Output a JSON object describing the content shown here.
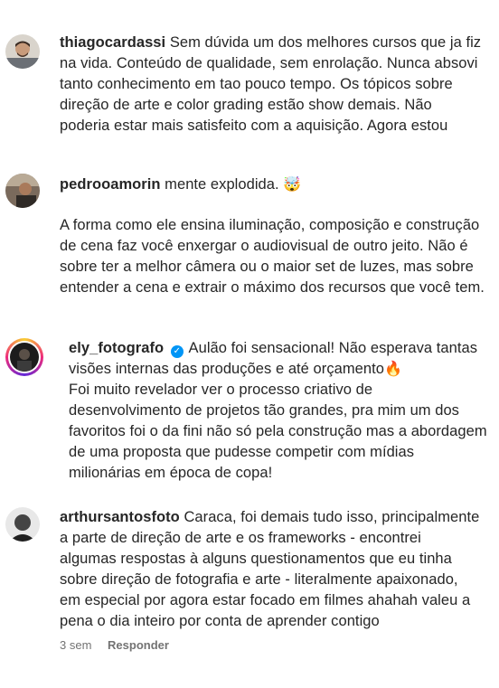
{
  "comments": [
    {
      "username": "thiagocardassi",
      "lines": [
        "Sem dúvida um dos melhores cursos que ja fiz",
        "na vida. Conteúdo de qualidade, sem enrolação. Nunca absovi",
        "tanto conhecimento em tao pouco tempo. Os tópicos sobre",
        "direção de arte e color grading estão show demais. Não",
        "poderia estar mais satisfeito com a aquisição. Agora estou"
      ]
    },
    {
      "username": "pedrooamorin",
      "first_text": "mente explodida.",
      "emoji": "🤯",
      "paragraph": [
        "A forma como ele ensina iluminação, composição e construção",
        "de cena faz você enxergar o audiovisual de outro jeito. Não é",
        "sobre ter a melhor câmera ou o maior set de luzes, mas sobre",
        "entender a cena e extrair o máximo dos recursos que você tem."
      ]
    },
    {
      "username": "ely_fotografo",
      "verified": "✓",
      "first_text": "Aulão foi sensacional! Não esperava tantas",
      "second_text": "visões internas das produções e até orçamento",
      "emoji": "🔥",
      "paragraph": [
        "Foi muito revelador ver o processo criativo de",
        "desenvolvimento de projetos tão grandes, pra mim um dos",
        "favoritos foi o da fini não só pela construção mas a abordagem",
        "de uma proposta que pudesse competir com mídias",
        "milionárias em época de copa!"
      ]
    },
    {
      "username": "arthursantosfoto",
      "lines": [
        "Caraca, foi demais tudo isso, principalmente",
        "a parte de direção de arte e os frameworks - encontrei",
        "algumas respostas à alguns questionamentos que eu tinha",
        "sobre direção de fotografia e arte - literalmente apaixonado,",
        "em especial por agora estar focado em filmes ahahah valeu a",
        "pena o dia inteiro por conta de aprender contigo"
      ],
      "time": "3 sem",
      "reply_label": "Responder"
    }
  ]
}
